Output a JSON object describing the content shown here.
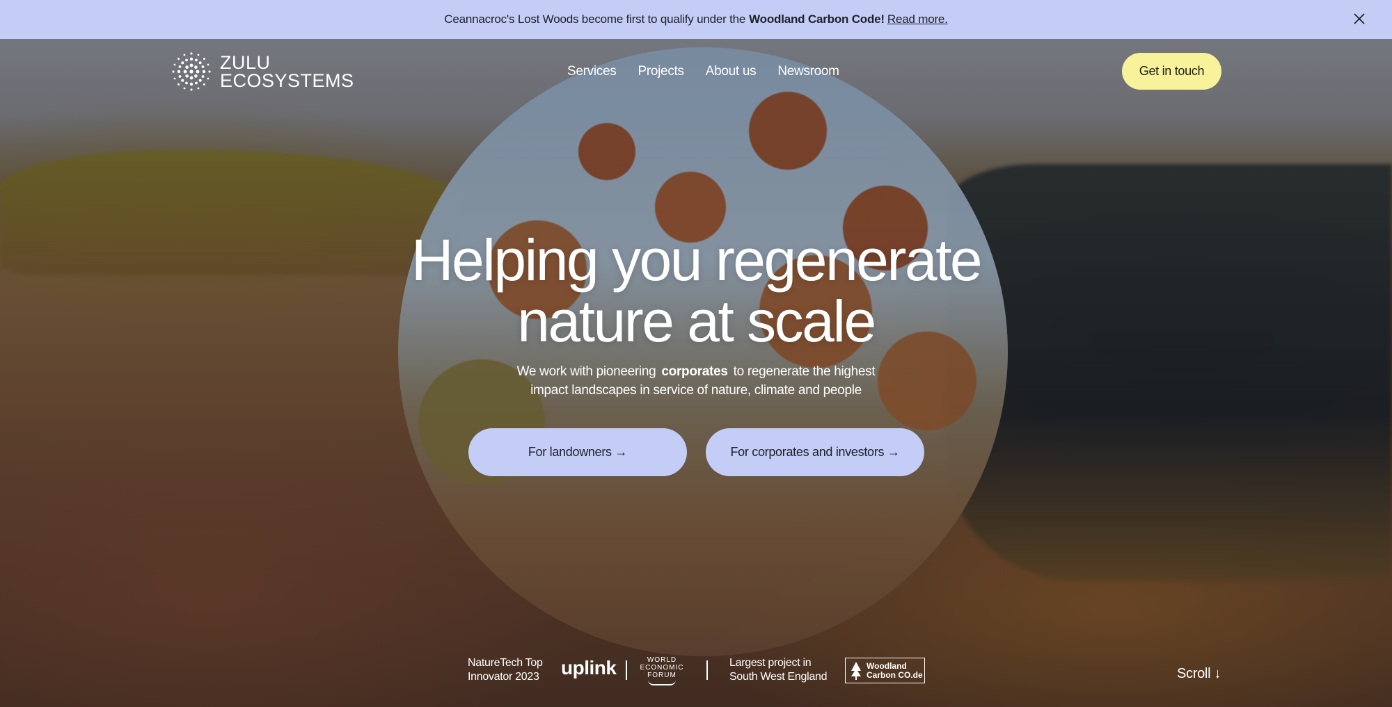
{
  "announcement": {
    "text": "Ceannacroc's Lost Woods become first to qualify under the",
    "bold": "Woodland Carbon Code!",
    "link": "Read more.",
    "close_icon": "close-icon"
  },
  "nav": {
    "logo_line1": "ZULU",
    "logo_line2": "ECOSYSTEMS",
    "items": [
      {
        "label": "Services"
      },
      {
        "label": "Projects"
      },
      {
        "label": "About us"
      },
      {
        "label": "Newsroom"
      }
    ],
    "cta": "Get in touch"
  },
  "hero": {
    "headline_line1": "Helping you regenerate",
    "headline_line2": "nature at scale",
    "sub_before": "We work with pioneering",
    "sub_highlight": "corporates",
    "sub_after": "to regenerate the highest",
    "sub_line2": "impact landscapes in service of nature, climate and people",
    "btn_landowners": "For landowners →",
    "btn_corporates": "For corporates and investors →"
  },
  "credentials": {
    "award1_line1": "NatureTech Top",
    "award1_line2": "Innovator 2023",
    "uplink": "uplink",
    "wef_line1": "WORLD",
    "wef_line2": "ECONOMIC",
    "wef_line3": "FORUM",
    "award2_line1": "Largest project in",
    "award2_line2": "South West England",
    "wcc_line1": "Woodland",
    "wcc_line2": "Carbon CO.de"
  },
  "scroll": "Scroll ↓",
  "colors": {
    "announcement_bg": "#c3cdf5",
    "cta_bg": "#f8f39a",
    "button_bg": "#c3cdf5"
  }
}
